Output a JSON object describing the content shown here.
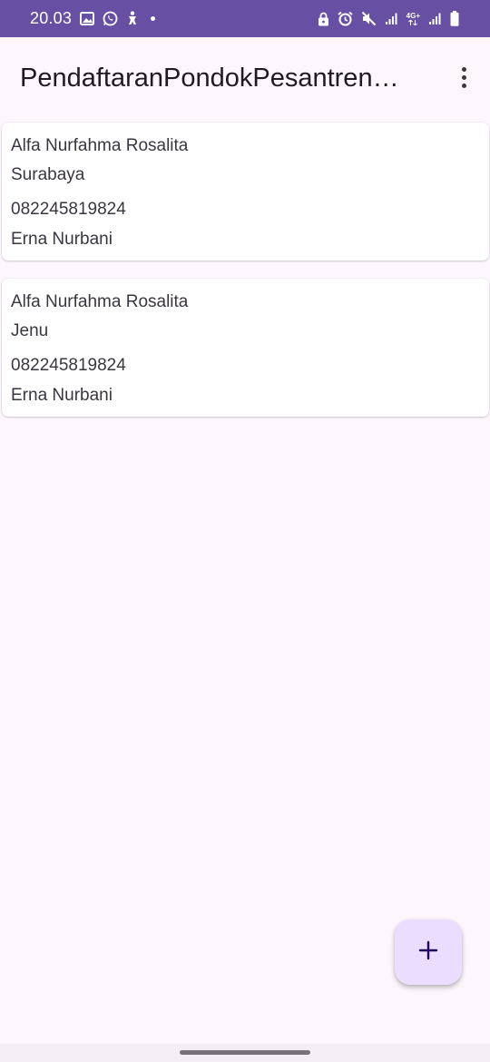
{
  "status_bar": {
    "time": "20.03",
    "left_icons": [
      "image-icon",
      "whatsapp-icon",
      "accessibility-icon",
      "dot-icon"
    ],
    "right_icons": [
      "lock-icon",
      "alarm-icon",
      "mute-icon",
      "signal-icon",
      "network-4g-icon",
      "signal-icon",
      "battery-icon"
    ],
    "network_label": "4G+",
    "background_color": "#6750a4"
  },
  "app_bar": {
    "title": "PendaftaranPondokPesantren…",
    "menu_icon": "more-vert-icon"
  },
  "cards": [
    {
      "name": "Alfa Nurfahma Rosalita",
      "city": "Surabaya",
      "phone": "082245819824",
      "parent": "Erna Nurbani"
    },
    {
      "name": "Alfa Nurfahma Rosalita",
      "city": "Jenu",
      "phone": "082245819824",
      "parent": "Erna Nurbani"
    }
  ],
  "fab": {
    "icon": "add-icon",
    "color": "#eaddff"
  }
}
